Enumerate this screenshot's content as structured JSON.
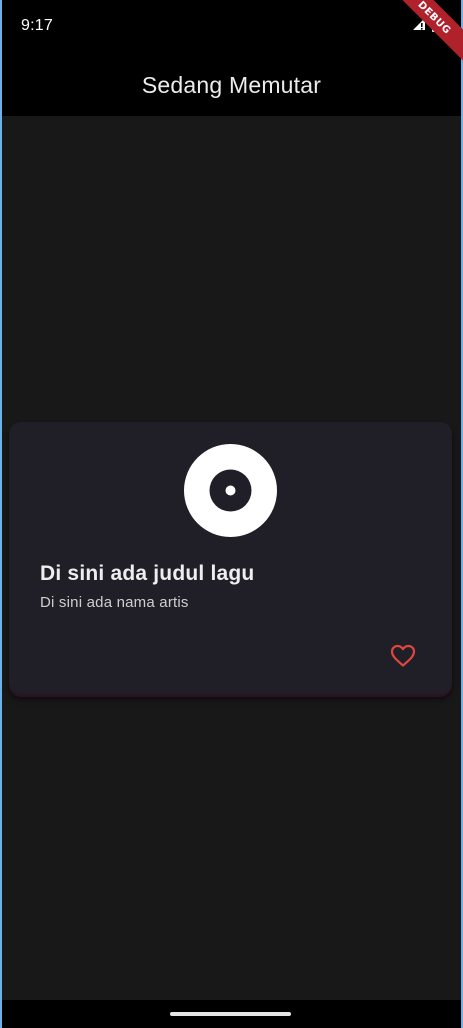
{
  "status_bar": {
    "time": "9:17"
  },
  "app_bar": {
    "title": "Sedang Memutar"
  },
  "debug_banner": {
    "label": "DEBUG"
  },
  "now_playing": {
    "song_title": "Di sini ada judul lagu",
    "artist_name": "Di sini ada nama artis",
    "icon": "album-disc-icon",
    "favorite_icon": "heart-outline-icon"
  },
  "colors": {
    "background": "#181818",
    "card": "#201f27",
    "app_bar": "#000000",
    "accent_heart": "#e0463e",
    "debug_banner": "#b0222b"
  }
}
